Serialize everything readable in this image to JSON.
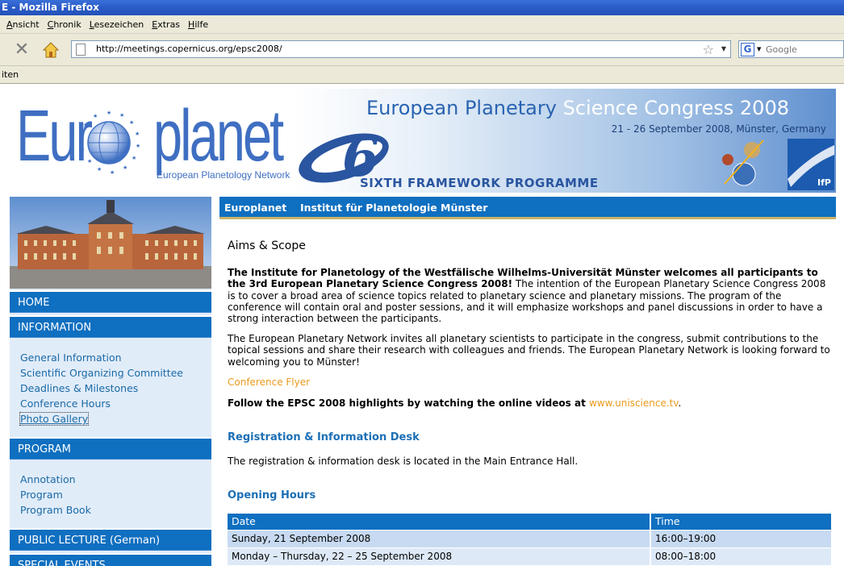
{
  "window": {
    "title": "E - Mozilla Firefox"
  },
  "menubar": {
    "items": [
      "Ansicht",
      "Chronik",
      "Lesezeichen",
      "Extras",
      "Hilfe"
    ]
  },
  "navbar": {
    "url": "http://meetings.copernicus.org/epsc2008/",
    "search_placeholder": "Google",
    "search_engine_letter": "G"
  },
  "bookmarks": {
    "fragment": "iten"
  },
  "banner": {
    "logo_part1": "Eur",
    "logo_part2": "planet",
    "logo_tagline": "European Planetology Network",
    "congress_title_blue": "European Planetary",
    "congress_title_white": "Science Congress 2008",
    "congress_date": "21 - 26 September 2008, Münster, Germany",
    "fp6_number": "6",
    "fp6_label": "SIXTH FRAMEWORK PROGRAMME",
    "ifp_label": "IfP"
  },
  "sidebar": {
    "home": "HOME",
    "information": "INFORMATION",
    "info_links": [
      "General Information",
      "Scientific Organizing Committee",
      "Deadlines & Milestones",
      "Conference Hours",
      "Photo Gallery"
    ],
    "program": "PROGRAM",
    "program_links": [
      "Annotation",
      "Program",
      "Program Book"
    ],
    "public_lecture": "PUBLIC LECTURE (German)",
    "special_events": "SPECIAL EVENTS"
  },
  "topnav": {
    "item1": "Europlanet",
    "item2": "Institut für Planetologie Münster"
  },
  "main": {
    "heading": "Aims & Scope",
    "intro_bold": "The Institute for Planetology of the Westfälische Wilhelms-Universität Münster welcomes all participants to the 3rd European Planetary Science Congress 2008!",
    "intro_rest": " The intention of the European Planetary Science Congress 2008 is to cover a broad area of science topics related to planetary science and planetary missions. The program of the conference will contain oral and poster sessions, and it will emphasize workshops and panel discussions in order to have a strong interaction between the participants.",
    "network_para": "The European Planetary Network invites all planetary scientists to participate in the congress, submit contributions to the topical sessions and share their research with colleagues and friends. The European Planetary Network is looking forward to welcoming you to Münster!",
    "flyer_link": "Conference Flyer",
    "videos_text": "Follow the  EPSC 2008 highlights by watching the online videos at ",
    "videos_link": "www.uniscience.tv",
    "videos_end": ".",
    "registration_heading": "Registration & Information Desk",
    "registration_text": "The registration & information desk is located in the Main Entrance Hall.",
    "hours_heading": "Opening Hours",
    "table": {
      "headers": [
        "Date",
        "Time"
      ],
      "rows": [
        [
          "Sunday, 21 September 2008",
          "16:00–19:00"
        ],
        [
          "Monday – Thursday, 22 – 25 September 2008",
          "08:00–18:00"
        ]
      ]
    }
  },
  "colors": {
    "nav_blue": "#0f6fc0",
    "link_blue": "#1a6aa6",
    "orange_link": "#e99a1c",
    "sidebar_bg": "#e1ecf9"
  }
}
